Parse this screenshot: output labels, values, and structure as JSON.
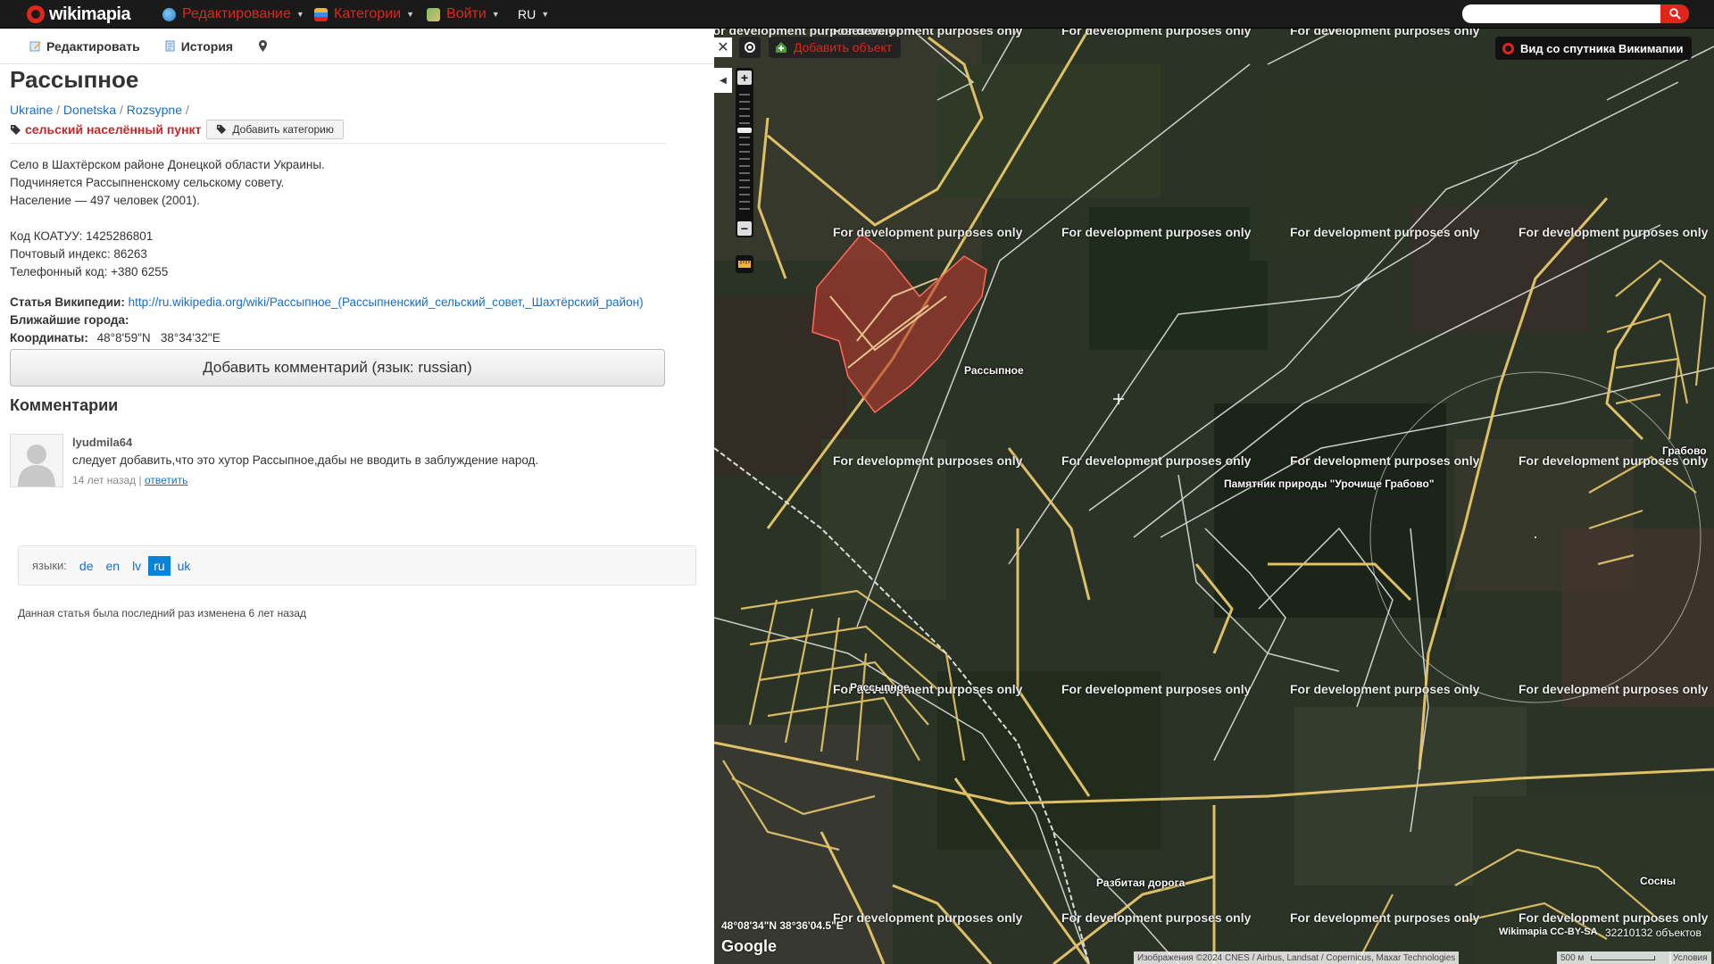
{
  "topbar": {
    "logo": "wikimapia",
    "menu": [
      {
        "label": "Редактирование",
        "icon": "globe-icon"
      },
      {
        "label": "Категории",
        "icon": "tree-icon"
      },
      {
        "label": "Войти",
        "icon": "card-icon"
      },
      {
        "label": "RU",
        "icon": "language-icon"
      }
    ],
    "search_placeholder": "",
    "accent": "#e0251b"
  },
  "panel": {
    "tabs": [
      {
        "label": "Редактировать",
        "icon": "pencil-icon"
      },
      {
        "label": "История",
        "icon": "history-icon"
      },
      {
        "label": "",
        "icon": "location-pin-icon"
      }
    ],
    "title": "Рассыпное",
    "breadcrumb": [
      "Ukraine",
      "Donetska",
      "Rozsypne"
    ],
    "breadcrumb_sep": "/",
    "category": "сельский населённый пункт",
    "add_category": "Добавить категорию",
    "description": [
      "Село в Шахтёрском районе Донецкой области Украины.",
      "Подчиняется Рассыпненскому сельскому совету.",
      "Население — 497 человек (2001)."
    ],
    "codes": [
      "Код КОАТУУ: 1425286801",
      "Почтовый индекс: 86263",
      "Телефонный код: +380 6255"
    ],
    "wiki_label": "Статья Википедии:",
    "wiki_url": "http://ru.wikipedia.org/wiki/Рассыпное_(Рассыпненский_сельский_совет,_Шахтёрский_район)",
    "nearest_label": "Ближайшие города:",
    "coords_label": "Координаты:",
    "coords_value": "48°8'59\"N   38°34'32\"E",
    "add_comment": "Добавить комментарий (язык: russian)",
    "comments_heading": "Комментарии",
    "comment": {
      "author": "lyudmila64",
      "text": "следует добавить,что это хутор Рассыпное,дабы не вводить в заблуждение народ.",
      "time": "14 лет назад",
      "sep": "|",
      "reply": "ответить"
    },
    "languages_label": "языки:",
    "languages": [
      "de",
      "en",
      "lv",
      "ru",
      "uk"
    ],
    "active_language": "ru",
    "last_edit": "Данная статья была последний раз изменена 6 лет назад"
  },
  "map": {
    "close": "✕",
    "collapse": "◀",
    "add_object": "Добавить объект",
    "satellite_button": "Вид со спутника Викимапии",
    "watermark": "For development purposes only",
    "labels": {
      "rassypnoe_top": "Рассыпное",
      "monument": "Памятник природы \"Урочище Грабово\"",
      "grabovo": "Грабово",
      "rassypnoe_bottom": "Рассыпное",
      "road": "Разбитая дорога",
      "sosny": "Сосны"
    },
    "cursor_coords": "48°08'34\"N 38°36'04.5\"E",
    "google": "Google",
    "license": "Wikimapia CC-BY-SA",
    "object_count": "32210132 объектов",
    "attribution": "Изображения ©2024 CNES / Airbus, Landsat / Copernicus, Maxar Technologies",
    "scale": "500 м",
    "terms": "Условия"
  }
}
